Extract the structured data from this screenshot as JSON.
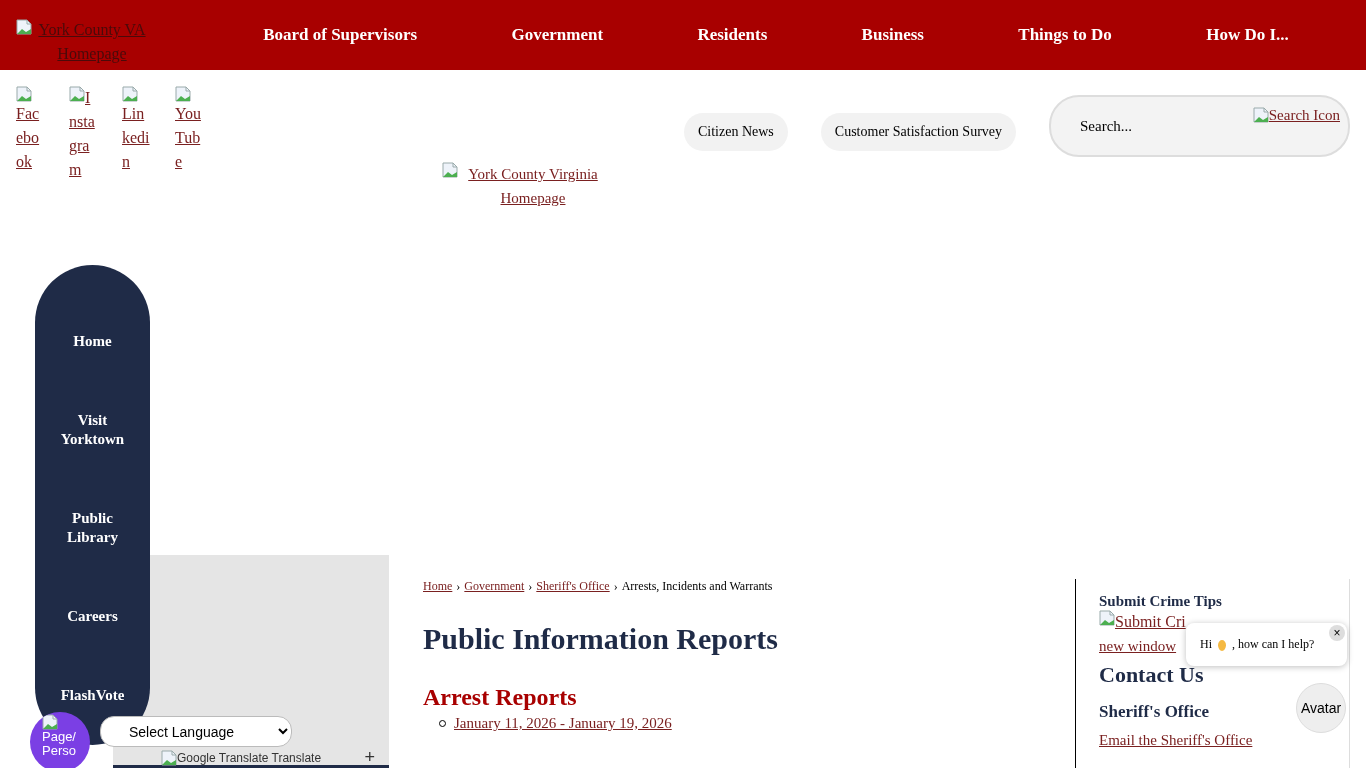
{
  "header": {
    "logo_alt": "York County VA Homepage",
    "nav": [
      "Board of Supervisors",
      "Government",
      "Residents",
      "Business",
      "Things to Do",
      "How Do I..."
    ]
  },
  "social": [
    {
      "alt": "Facebook",
      "kind": "below"
    },
    {
      "alt": "Instagram",
      "kind": "inline"
    },
    {
      "alt": "Linkedin",
      "kind": "below"
    },
    {
      "alt": "YouTube",
      "kind": "below"
    }
  ],
  "quick_links": [
    "Citizen News",
    "Customer Satisfaction Survey"
  ],
  "search": {
    "placeholder": "Search...",
    "icon_alt": "Search Icon"
  },
  "site_logo_alt": "York County Virginia Homepage",
  "side_nav": [
    "Home",
    "Visit Yorktown",
    "Public Library",
    "Careers",
    "FlashVote"
  ],
  "breadcrumb": [
    {
      "label": "Home",
      "link": true
    },
    {
      "separator": "›",
      "label": "Government",
      "link": true
    },
    {
      "separator": "›",
      "label": "Sheriff's Office",
      "link": true
    },
    {
      "separator": "›",
      "label": "Arrests, Incidents and Warrants",
      "link": false
    }
  ],
  "title": "Public Information Reports",
  "section": {
    "heading": "Arrest Reports",
    "items": [
      "January 11, 2026 - January 19, 2026"
    ]
  },
  "sidebar": {
    "tips_heading": "Submit Crime Tips",
    "tips_link_start": "Submit Cri",
    "tips_link_end": "new window",
    "contact_heading": "Contact Us",
    "office_heading": "Sheriff's Office",
    "email_link": "Email the Sheriff's Office"
  },
  "chat": {
    "greeting": "Hi",
    "question": ", how can I help?",
    "close": "×",
    "avatar": "Avatar"
  },
  "language_select": "Select Language",
  "translate_alt": "Google Translate Translate",
  "page_person": [
    "Page/",
    "Perso"
  ],
  "accordion_toggle": "+"
}
